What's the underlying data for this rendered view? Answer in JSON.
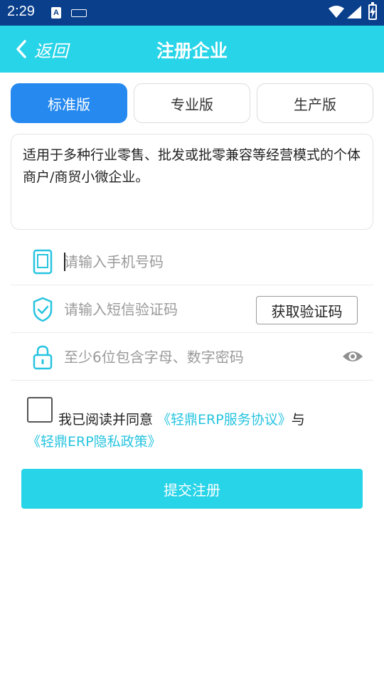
{
  "status_bar": {
    "time": "2:29",
    "app_icon_letter": "A"
  },
  "appbar": {
    "back_label": "返回",
    "title": "注册企业"
  },
  "tabs": [
    {
      "label": "标准版",
      "active": true
    },
    {
      "label": "专业版",
      "active": false
    },
    {
      "label": "生产版",
      "active": false
    }
  ],
  "description": "适用于多种行业零售、批发或批零兼容等经营模式的个体商户/商贸小微企业。",
  "form": {
    "phone_placeholder": "请输入手机号码",
    "sms_placeholder": "请输入短信验证码",
    "get_code_label": "获取验证码",
    "password_placeholder": "至少6位包含字母、数字密码"
  },
  "agreement": {
    "prefix": "我已阅读并同意 ",
    "service_link": "《轻鼎ERP服务协议》",
    "joiner": "与",
    "privacy_link": "《轻鼎ERP隐私政策》"
  },
  "submit_label": "提交注册",
  "colors": {
    "accent": "#27d4e8",
    "tab_active": "#2589f0",
    "status_bar": "#0a3f8c",
    "link": "#27c4e0"
  }
}
